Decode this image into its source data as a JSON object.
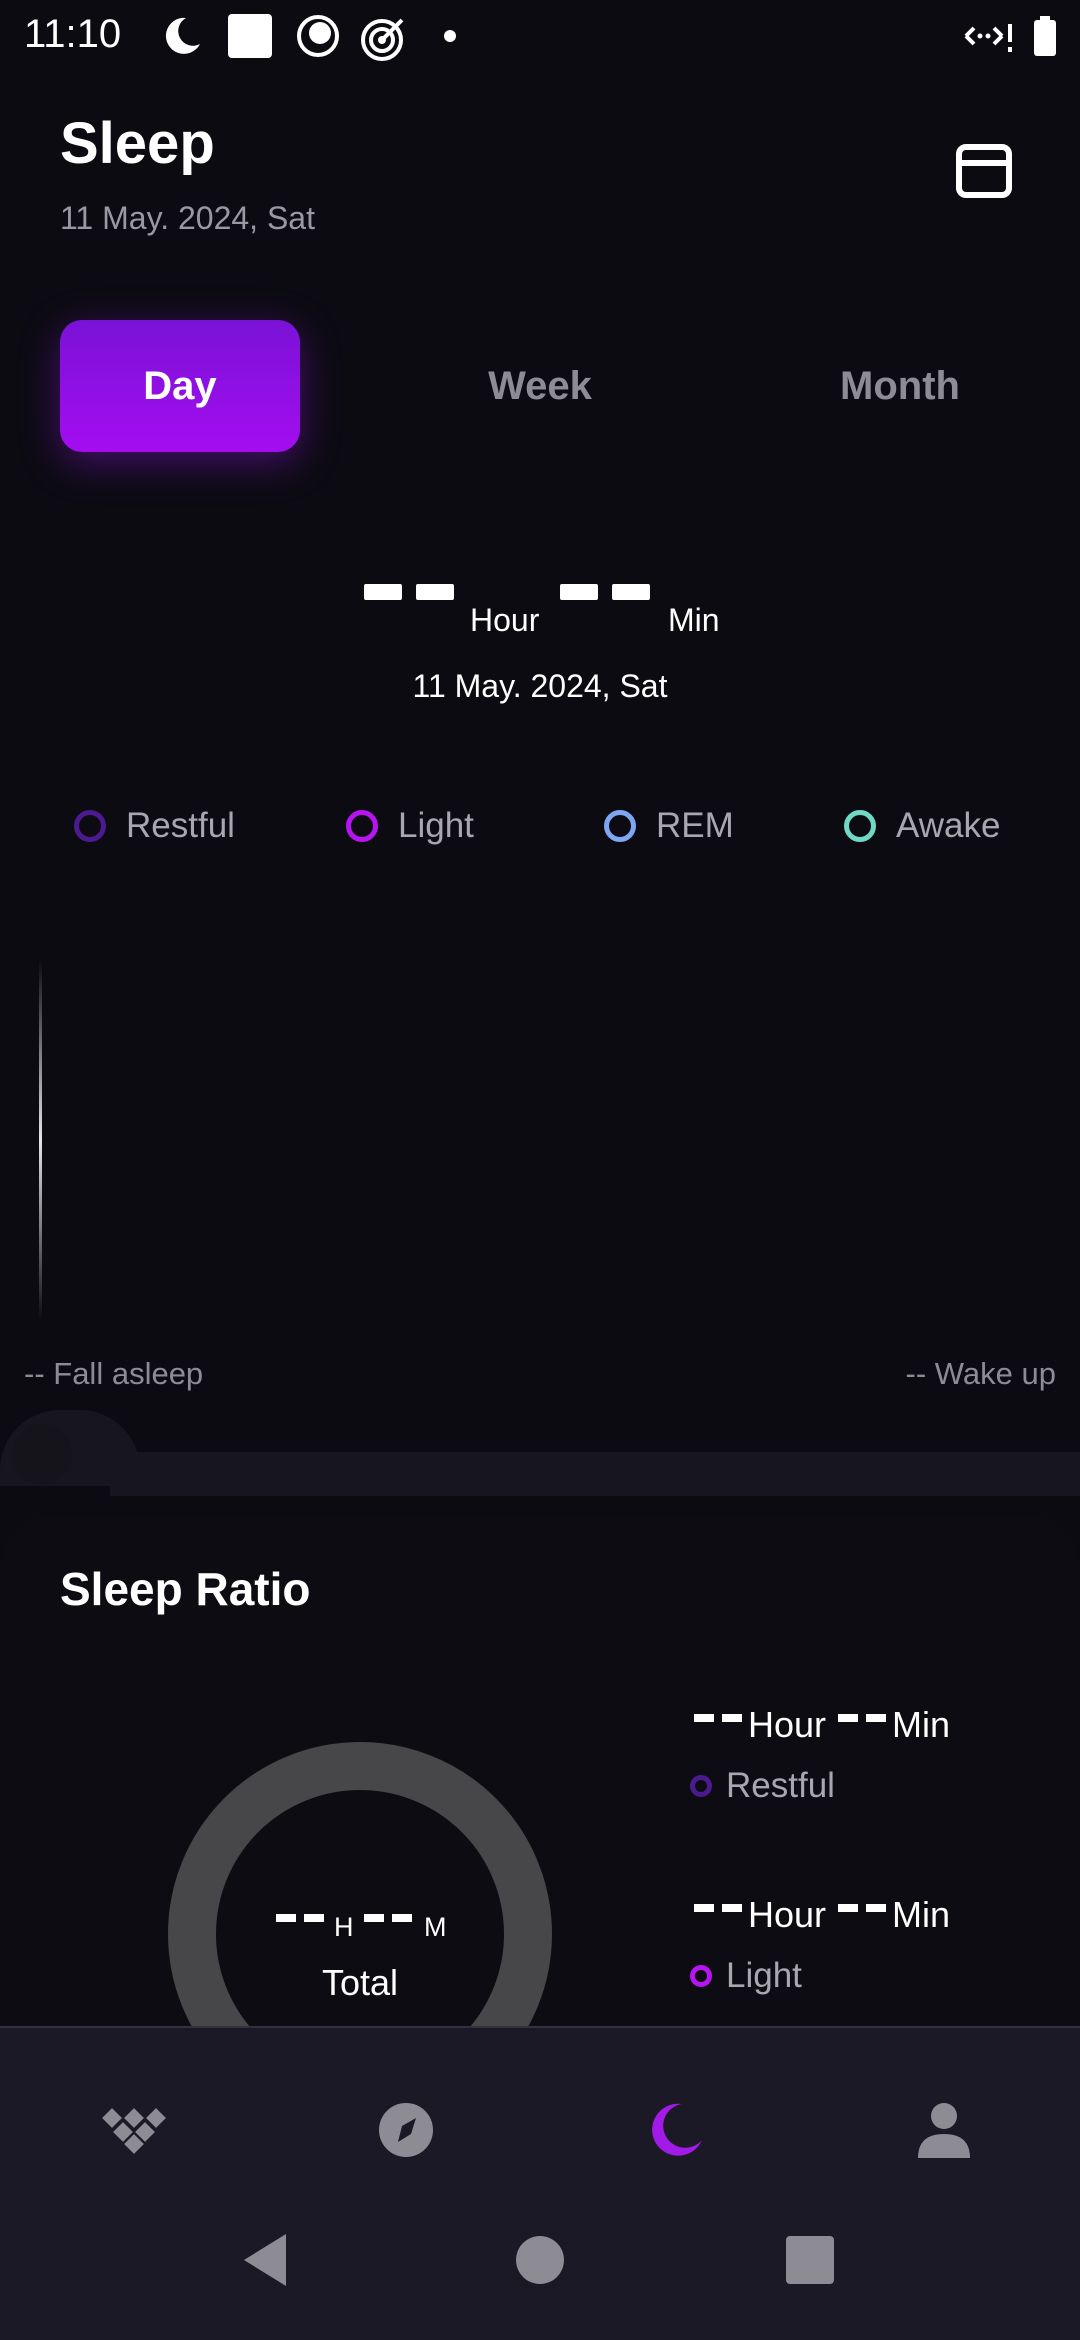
{
  "status_bar": {
    "time": "11:10",
    "icons": [
      "moon-clock-icon",
      "white-square-icon",
      "eye-circle-icon",
      "target-icon",
      "dot-icon",
      "data-signal-icon",
      "battery-icon"
    ]
  },
  "header": {
    "title": "Sleep",
    "date": "11 May. 2024, Sat",
    "calendar_icon": "calendar-icon"
  },
  "tabs": [
    {
      "label": "Day",
      "active": true
    },
    {
      "label": "Week",
      "active": false
    },
    {
      "label": "Month",
      "active": false
    }
  ],
  "summary": {
    "hour_unit": "Hour",
    "min_unit": "Min",
    "date": "11 May. 2024, Sat"
  },
  "legend": [
    {
      "label": "Restful",
      "color": "#4b1a8f"
    },
    {
      "label": "Light",
      "color": "#b614f0"
    },
    {
      "label": "REM",
      "color": "#7ea6f2"
    },
    {
      "label": "Awake",
      "color": "#6fd9c4"
    }
  ],
  "chart": {
    "fall_asleep": "-- Fall asleep",
    "wake_up": "-- Wake up"
  },
  "sleep_ratio": {
    "title": "Sleep Ratio",
    "donut": {
      "h_unit": "H",
      "m_unit": "M",
      "total_label": "Total",
      "ring_color": "#474648"
    },
    "stats": [
      {
        "hour_unit": "Hour",
        "min_unit": "Min",
        "label": "Restful",
        "color": "#4b1a8f"
      },
      {
        "hour_unit": "Hour",
        "min_unit": "Min",
        "label": "Light",
        "color": "#b614f0"
      }
    ]
  },
  "bottom_nav": {
    "items": [
      {
        "name": "dashboard-icon",
        "active": false
      },
      {
        "name": "compass-icon",
        "active": false
      },
      {
        "name": "moon-icon",
        "active": true
      },
      {
        "name": "profile-icon",
        "active": false
      }
    ],
    "accent": "#a11ae6",
    "inactive": "#8d8c95"
  },
  "system_nav": [
    "back-icon",
    "home-icon",
    "recents-icon"
  ]
}
